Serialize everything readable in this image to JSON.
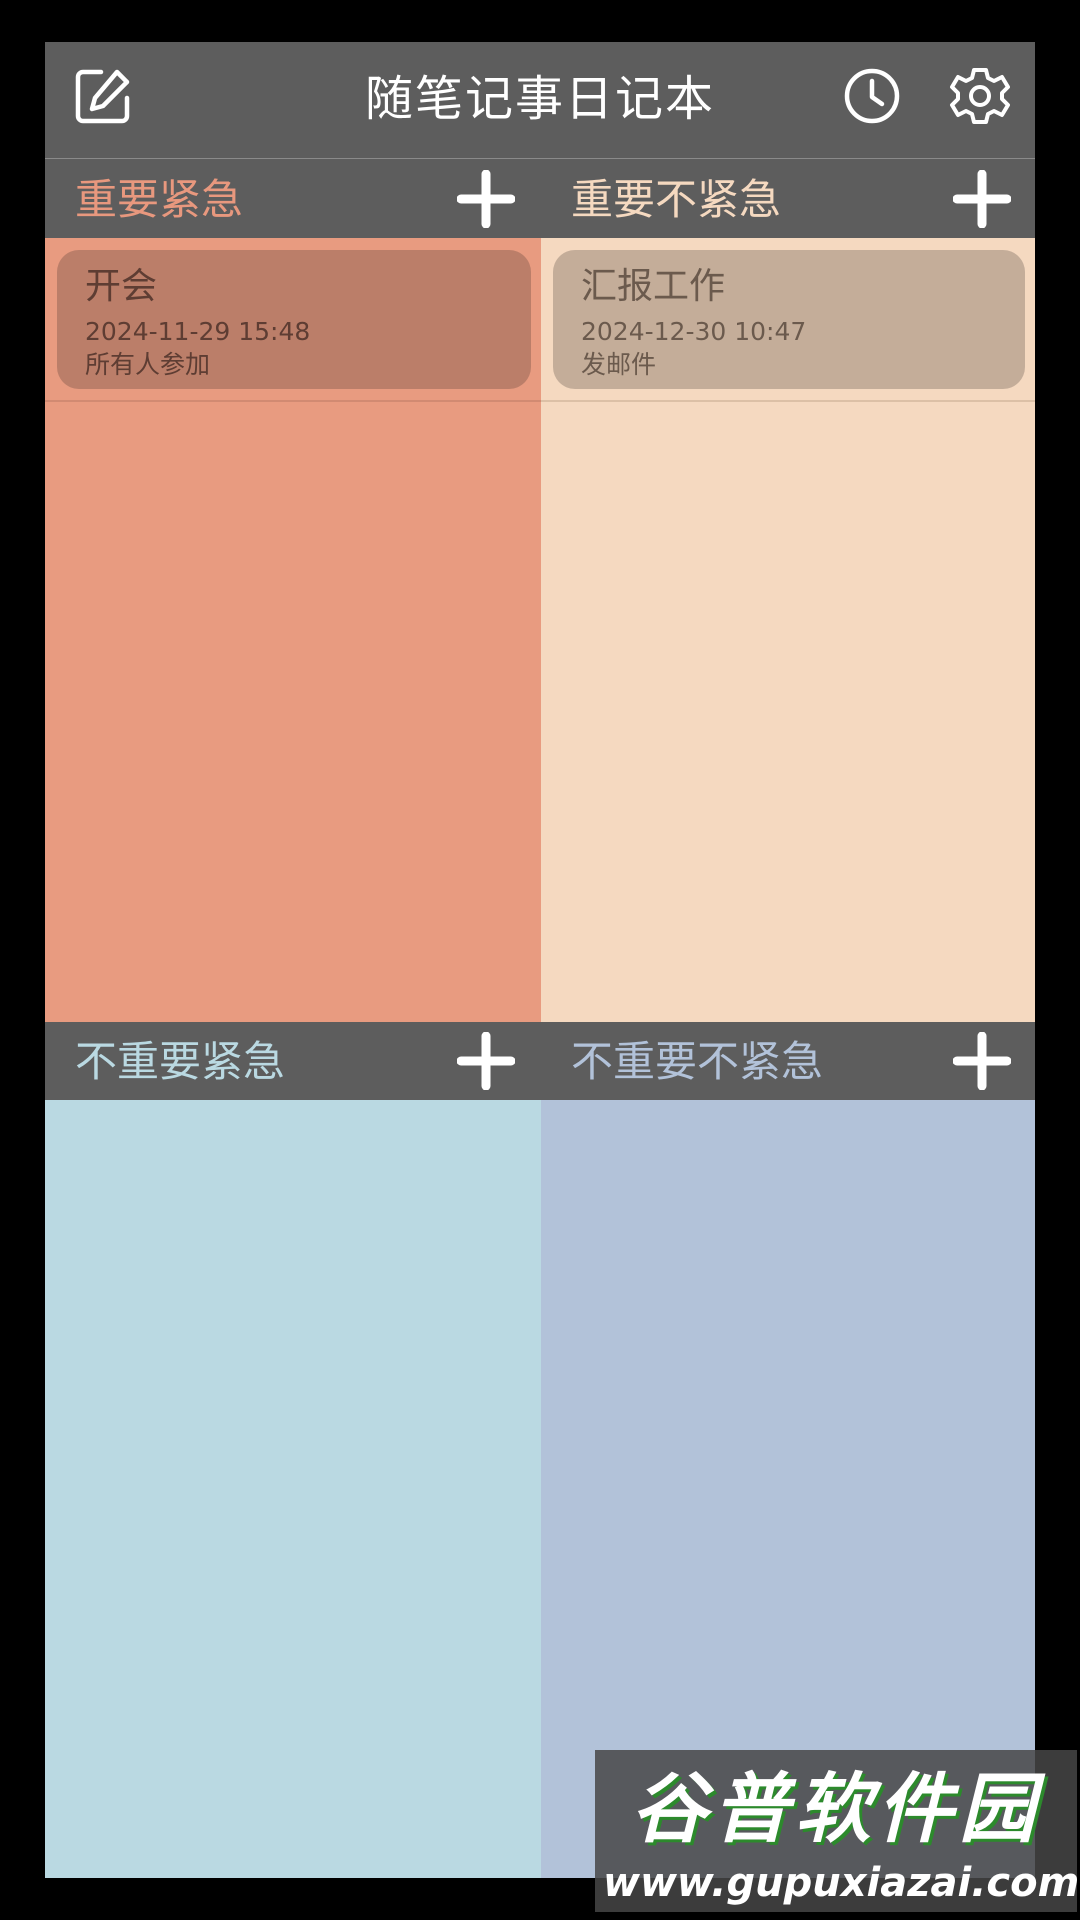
{
  "app": {
    "title": "随笔记事日记本",
    "icons": {
      "left": "edit-icon",
      "history": "clock-icon",
      "settings": "gear-icon",
      "add": "plus-icon"
    }
  },
  "quadrants": [
    {
      "title": "重要紧急",
      "title_color": "#e8987e",
      "bg_color": "#e89b80",
      "note_color": "#bb7e69",
      "notes": [
        {
          "title": "开会",
          "datetime": "2024-11-29 15:48",
          "desc": "所有人参加"
        }
      ]
    },
    {
      "title": "重要不紧急",
      "title_color": "#f5d9c0",
      "bg_color": "#f5d9c0",
      "note_color": "#c4ad99",
      "notes": [
        {
          "title": "汇报工作",
          "datetime": "2024-12-30 10:47",
          "desc": "发邮件"
        }
      ]
    },
    {
      "title": "不重要紧急",
      "title_color": "#bad9e2",
      "bg_color": "#bad9e2",
      "notes": []
    },
    {
      "title": "不重要不紧急",
      "title_color": "#b2c2d9",
      "bg_color": "#b2c2d9",
      "notes": []
    }
  ],
  "watermark": {
    "text": "谷普软件园",
    "url": "www.gupuxiazai.com"
  }
}
